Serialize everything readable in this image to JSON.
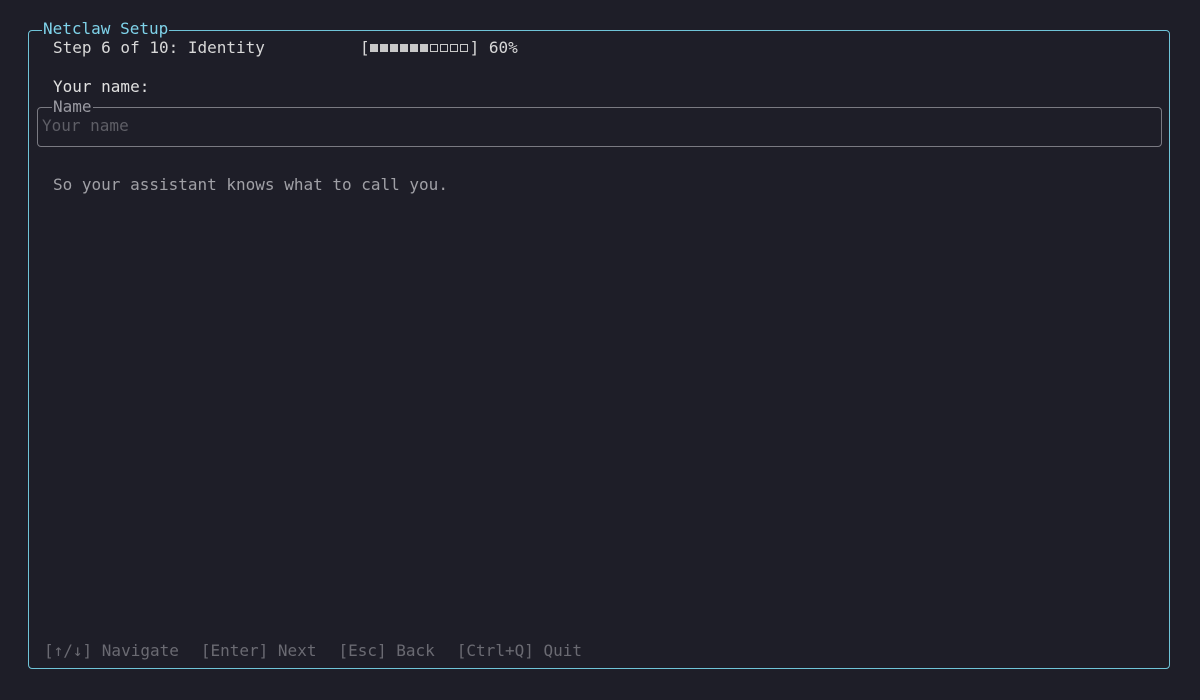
{
  "window": {
    "title": "Netclaw Setup"
  },
  "step": {
    "text": "Step 6 of 10: Identity",
    "progress_filled": 6,
    "progress_total": 10,
    "progress_percent": "60%"
  },
  "form": {
    "prompt_label": "Your name:",
    "field_legend": "Name",
    "field_value": "",
    "field_placeholder": "Your name",
    "hint": "So your assistant knows what to call you."
  },
  "footer": {
    "navigate": "[↑/↓] Navigate",
    "next": "[Enter] Next",
    "back": "[Esc] Back",
    "quit": "[Ctrl+Q] Quit"
  },
  "colors": {
    "background": "#1e1e28",
    "accent": "#7fd3ea",
    "frame_border": "#6fc4d8"
  }
}
